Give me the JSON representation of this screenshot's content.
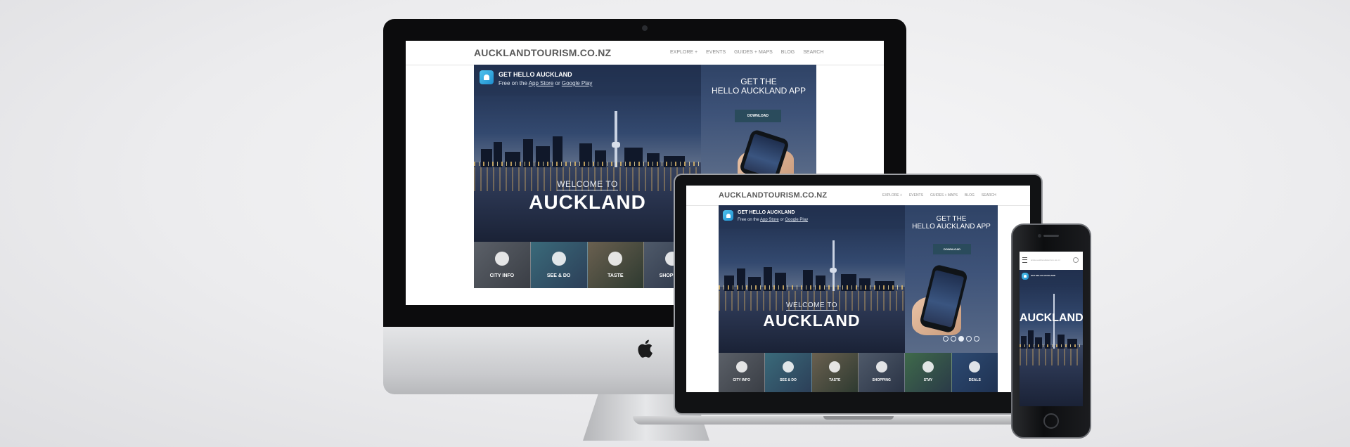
{
  "site": {
    "logo": "AUCKLANDTOURISM.CO.NZ",
    "nav": [
      "EXPLORE +",
      "EVENTS",
      "GUIDES + MAPS",
      "BLOG",
      "SEARCH"
    ]
  },
  "banner": {
    "title": "GET HELLO AUCKLAND",
    "sub_prefix": "Free on the ",
    "app_store": "App Store",
    "or": " or ",
    "google_play": "Google Play"
  },
  "hero": {
    "welcome": "WELCOME TO",
    "city": "AUCKLAND"
  },
  "promo": {
    "line1": "GET THE",
    "line2": "HELLO AUCKLAND APP",
    "download": "DOWNLOAD"
  },
  "tiles": [
    "CITY INFO",
    "SEE & DO",
    "TASTE",
    "SHOPPING",
    "STAY",
    "DEALS"
  ],
  "tiles_desktop_visible": [
    "CITY INFO",
    "SEE & DO",
    "TASTE",
    "SHOPPING"
  ],
  "phone": {
    "url": "www.aucklandtourism.co.nz",
    "banner": "GET HELLO AUCKLAND",
    "city": "AUCKLAND"
  },
  "colors": {
    "background": "#e9e9eb",
    "app_icon": "#3bb2e6",
    "download_button": "#2a4b5c"
  }
}
